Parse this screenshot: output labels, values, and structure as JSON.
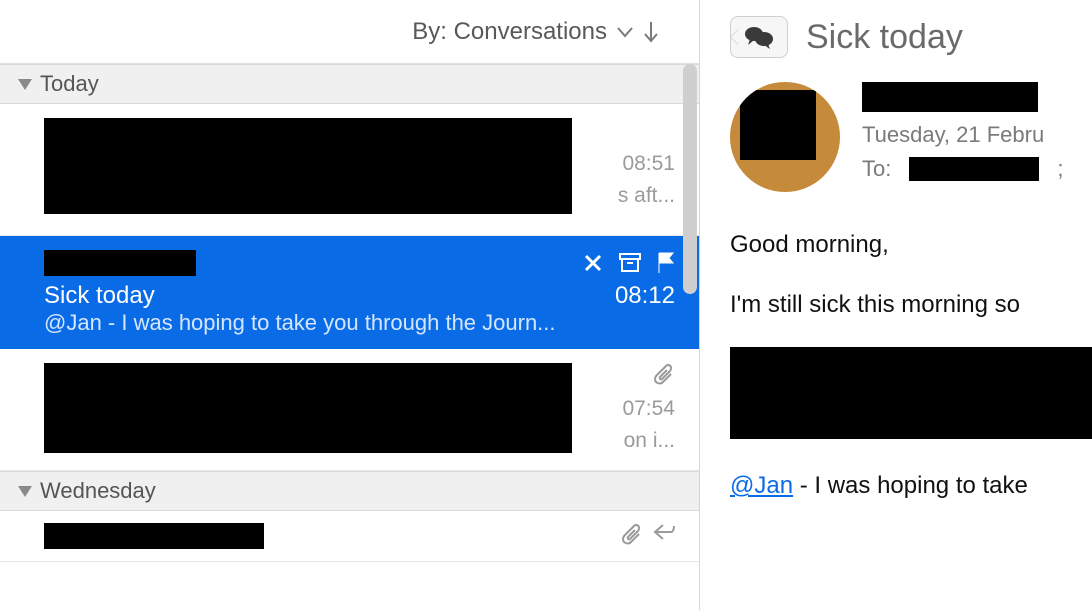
{
  "sortBar": {
    "label": "By: Conversations"
  },
  "sections": [
    {
      "title": "Today"
    },
    {
      "title": "Wednesday"
    }
  ],
  "messages": {
    "item0": {
      "time": "08:51",
      "previewFrag": "s aft..."
    },
    "selected": {
      "subject": "Sick today",
      "time": "08:12",
      "preview": "@Jan - I was hoping to take you through the Journ..."
    },
    "item2": {
      "time": "07:54",
      "previewFrag": "on i..."
    }
  },
  "reading": {
    "subject": "Sick today",
    "date": "Tuesday, 21 Febru",
    "toLabel": "To:",
    "toSuffix": ";",
    "body": {
      "line1": "Good morning,",
      "line2": "I'm still sick this morning so ",
      "mention": "@Jan",
      "line3rest": " - I was hoping to take "
    }
  }
}
